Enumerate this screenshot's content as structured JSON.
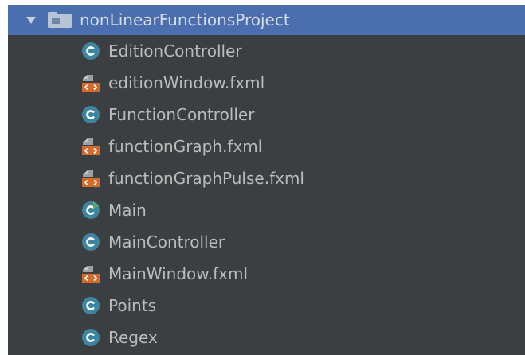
{
  "project": {
    "name": "nonLinearFunctionsProject",
    "expanded": true,
    "selected": true,
    "children": [
      {
        "label": "EditionController",
        "icon": "class-icon"
      },
      {
        "label": "editionWindow.fxml",
        "icon": "fxml-file-icon"
      },
      {
        "label": "FunctionController",
        "icon": "class-icon"
      },
      {
        "label": "functionGraph.fxml",
        "icon": "fxml-file-icon"
      },
      {
        "label": "functionGraphPulse.fxml",
        "icon": "fxml-file-icon"
      },
      {
        "label": "Main",
        "icon": "runnable-class-icon"
      },
      {
        "label": "MainController",
        "icon": "class-icon"
      },
      {
        "label": "MainWindow.fxml",
        "icon": "fxml-file-icon"
      },
      {
        "label": "Points",
        "icon": "class-icon"
      },
      {
        "label": "Regex",
        "icon": "class-icon"
      }
    ]
  },
  "colors": {
    "panel_background": "#3c3f41",
    "selection": "#4b6eaf",
    "text": "#bbbbbb",
    "class_icon": "#3e86a0",
    "fxml_icon": "#d26b2c",
    "run_marker": "#59a869"
  }
}
